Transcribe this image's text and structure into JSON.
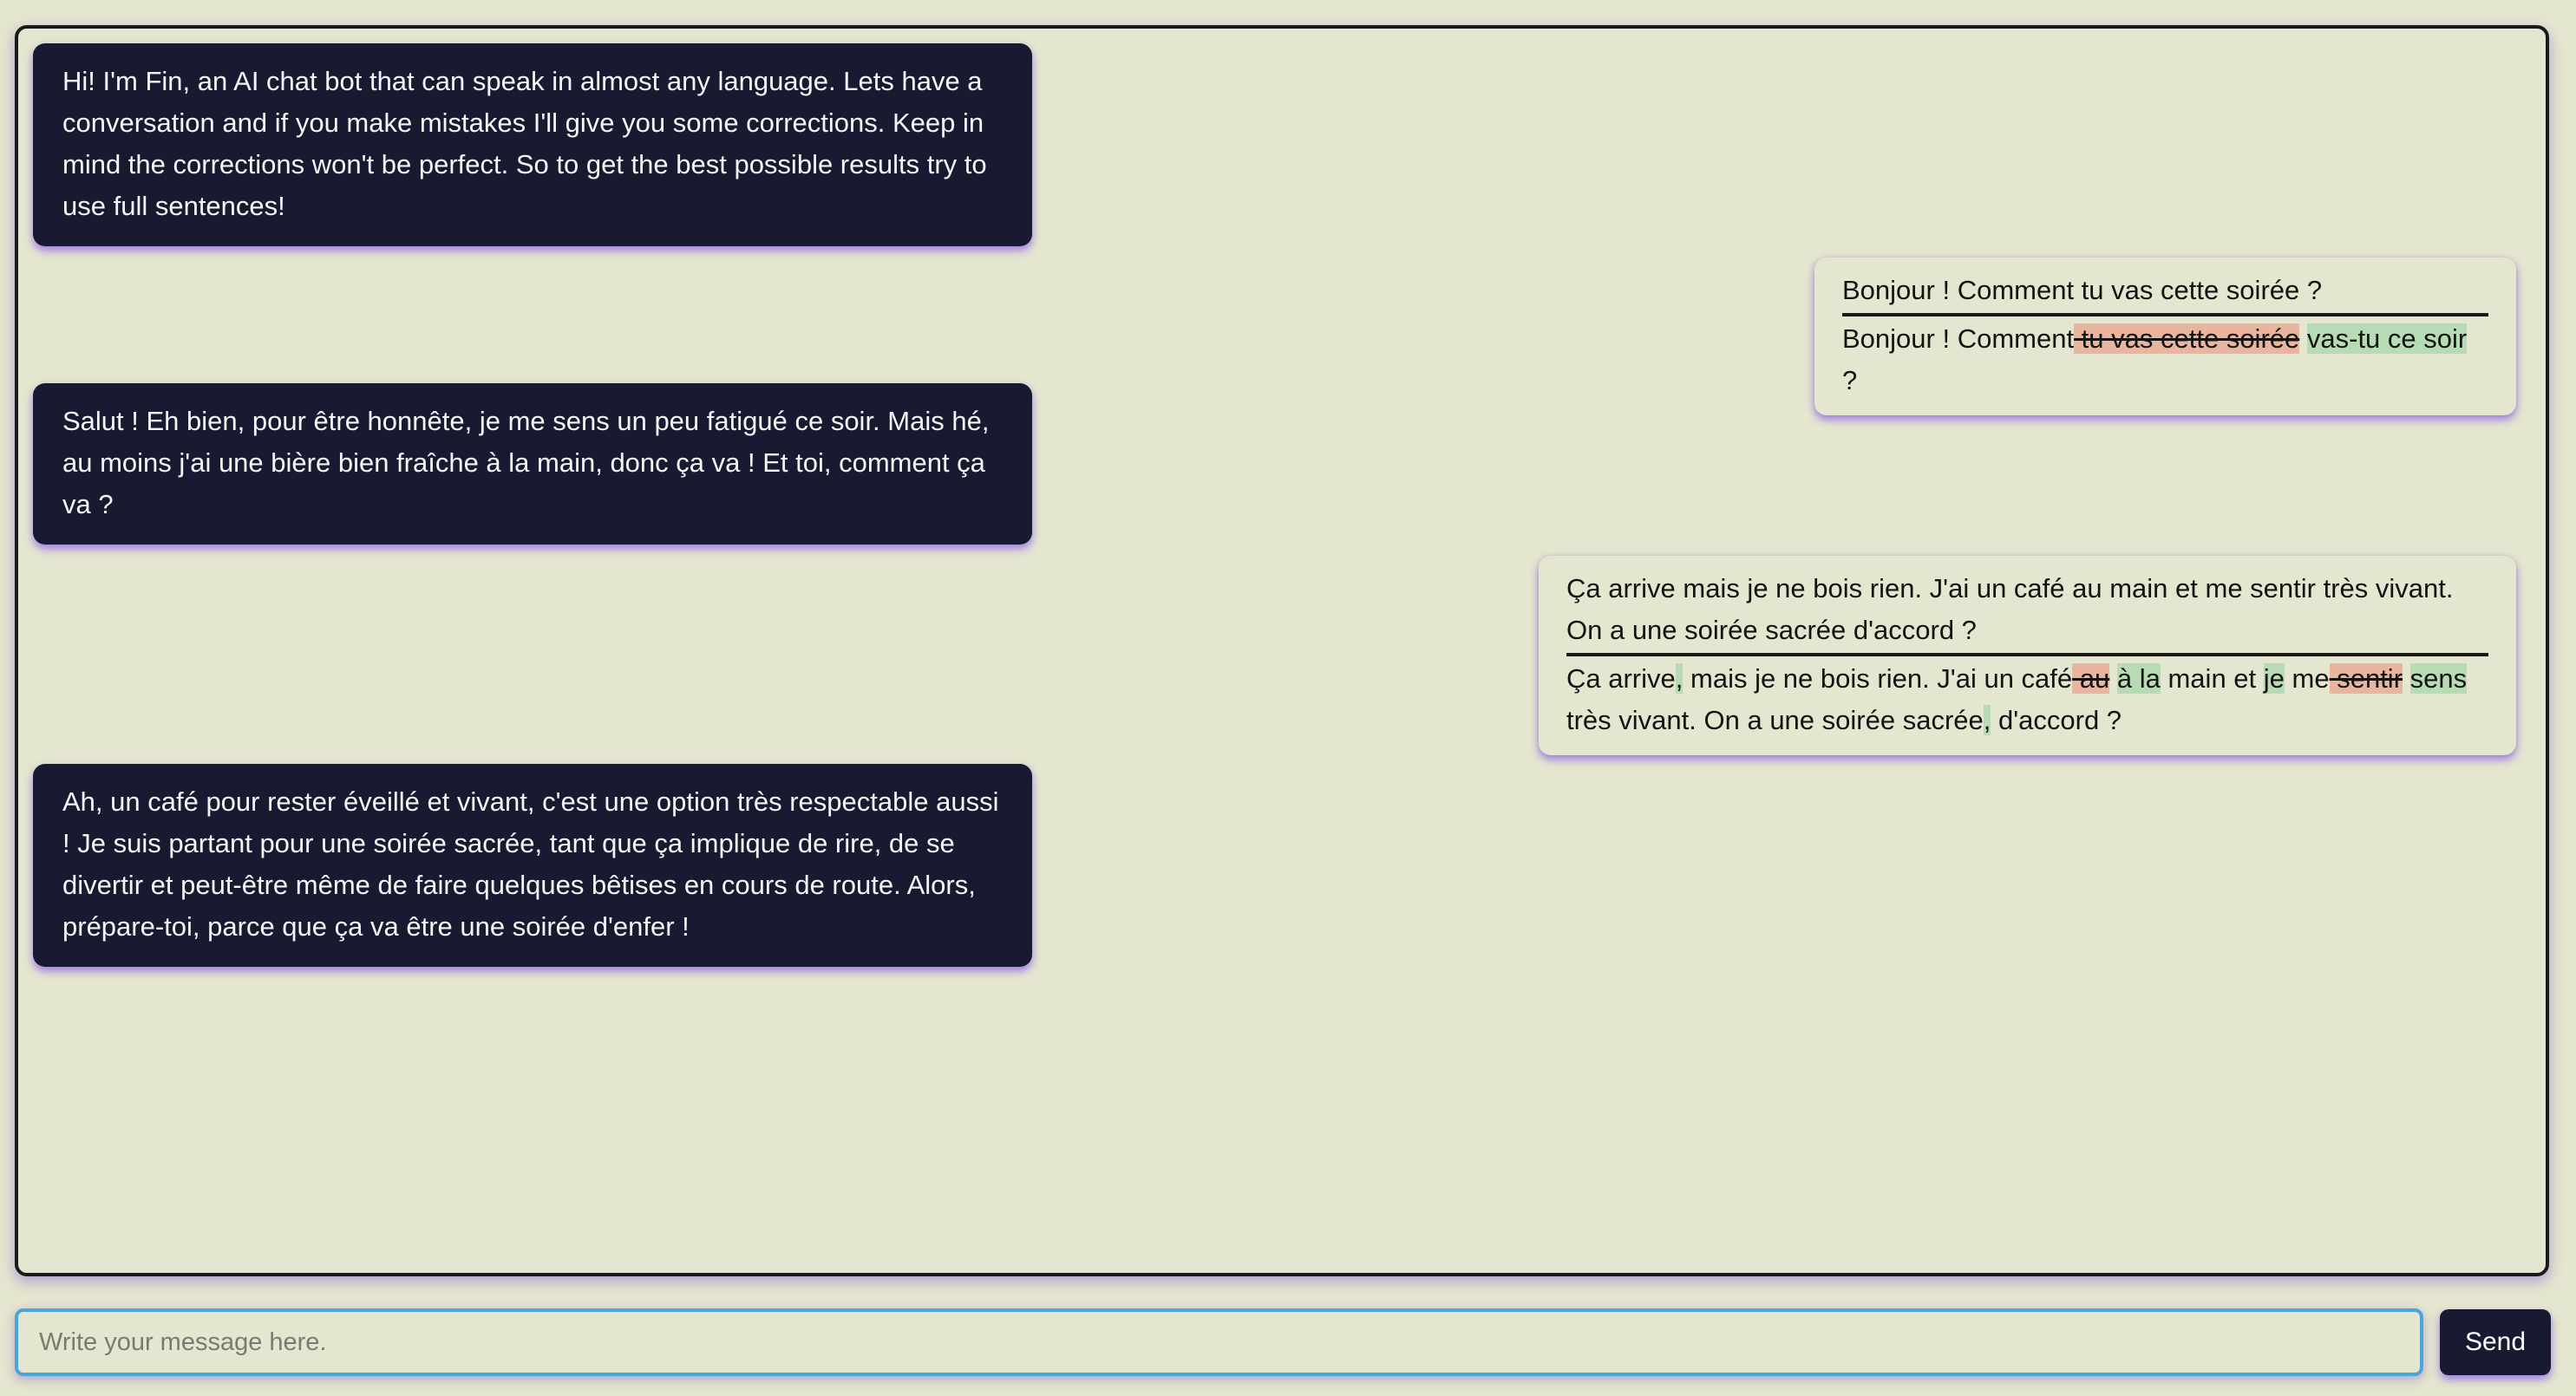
{
  "messages": [
    {
      "role": "bot",
      "text": "Hi! I'm Fin, an AI chat bot that can speak in almost any language. Lets have a conversation and if you make mistakes I'll give you some corrections. Keep in mind the corrections won't be perfect. So to get the best possible results try to use full sentences!"
    },
    {
      "role": "user",
      "original": "Bonjour ! Comment tu vas cette soirée ?",
      "corrected": [
        {
          "t": "Bonjour ! Comment"
        },
        {
          "t": " tu vas cette soirée",
          "type": "del"
        },
        {
          "t": " "
        },
        {
          "t": "vas-tu ce soir",
          "type": "ins"
        },
        {
          "t": " ?"
        }
      ]
    },
    {
      "role": "bot",
      "text": "Salut ! Eh bien, pour être honnête, je me sens un peu fatigué ce soir. Mais hé, au moins j'ai une bière bien fraîche à la main, donc ça va ! Et toi, comment ça va ?"
    },
    {
      "role": "user",
      "original": "Ça arrive mais je ne bois rien. J'ai un café au main et me sentir très vivant. On a une soirée sacrée d'accord ?",
      "corrected": [
        {
          "t": "Ça arrive"
        },
        {
          "t": ",",
          "type": "ins"
        },
        {
          "t": " mais je ne bois rien. J'ai un café"
        },
        {
          "t": " au",
          "type": "del"
        },
        {
          "t": " "
        },
        {
          "t": "à la",
          "type": "ins"
        },
        {
          "t": " main et "
        },
        {
          "t": "je",
          "type": "ins"
        },
        {
          "t": " me"
        },
        {
          "t": " sentir",
          "type": "del"
        },
        {
          "t": " "
        },
        {
          "t": "sens",
          "type": "ins"
        },
        {
          "t": " très vivant. On a une soirée sacrée"
        },
        {
          "t": ",",
          "type": "ins"
        },
        {
          "t": " d'accord ?"
        }
      ]
    },
    {
      "role": "bot",
      "text": "Ah, un café pour rester éveillé et vivant, c'est une option très respectable aussi ! Je suis partant pour une soirée sacrée, tant que ça implique de rire, de se divertir et peut-être même de faire quelques bêtises en cours de route. Alors, prépare-toi, parce que ça va être une soirée d'enfer !"
    }
  ],
  "composer": {
    "placeholder": "Write your message here.",
    "send_label": "Send"
  },
  "colors": {
    "bot_bubble": "#181a31",
    "background": "#e5e6cf",
    "deletion_highlight": "#e9b59f",
    "insertion_highlight": "#b7dcb5",
    "input_border": "#4aa6d9"
  }
}
